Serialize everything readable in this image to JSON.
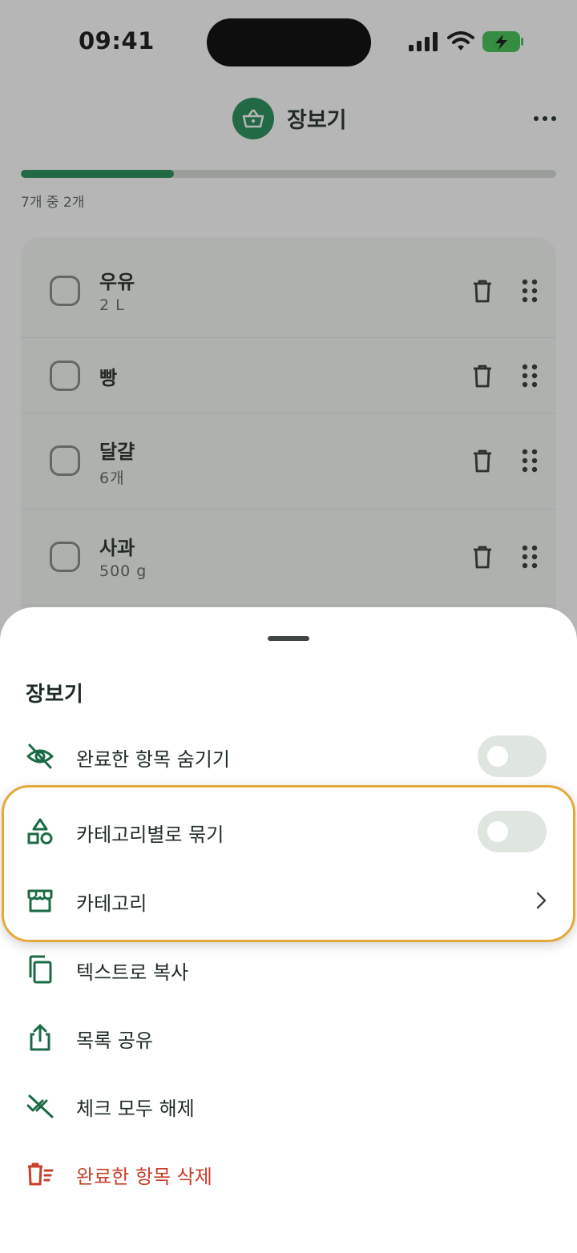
{
  "status_bar": {
    "time": "09:41"
  },
  "header": {
    "title": "장보기",
    "logo_icon": "basket-icon",
    "more_icon": "more-horizontal-icon"
  },
  "progress": {
    "completed": 2,
    "total": 7,
    "fraction": 0.2857,
    "label": "7개 중 2개"
  },
  "list": {
    "items": [
      {
        "name": "우유",
        "quantity": "2 L",
        "checked": false
      },
      {
        "name": "빵",
        "quantity": "",
        "checked": false
      },
      {
        "name": "달걀",
        "quantity": "6개",
        "checked": false
      },
      {
        "name": "사과",
        "quantity": "500 g",
        "checked": false
      }
    ]
  },
  "sheet": {
    "title": "장보기",
    "options": [
      {
        "label": "완료한 항목 숨기기",
        "icon": "eye-off-icon",
        "control": "toggle",
        "on": false
      },
      {
        "label": "카테고리별로 묶기",
        "icon": "shapes-icon",
        "control": "toggle",
        "on": false
      },
      {
        "label": "카테고리",
        "icon": "store-icon",
        "control": "chevron"
      },
      {
        "label": "텍스트로 복사",
        "icon": "copy-icon",
        "control": "none"
      },
      {
        "label": "목록 공유",
        "icon": "share-icon",
        "control": "none"
      },
      {
        "label": "체크 모두 해제",
        "icon": "uncheck-all-icon",
        "control": "none"
      },
      {
        "label": "완료한 항목 삭제",
        "icon": "delete-list-icon",
        "control": "none",
        "destructive": true
      }
    ]
  },
  "colors": {
    "accent": "#1f8a56",
    "destructive": "#c6402b",
    "highlight_border": "#e5a93a",
    "toggle_off": "#dfe6e0"
  }
}
